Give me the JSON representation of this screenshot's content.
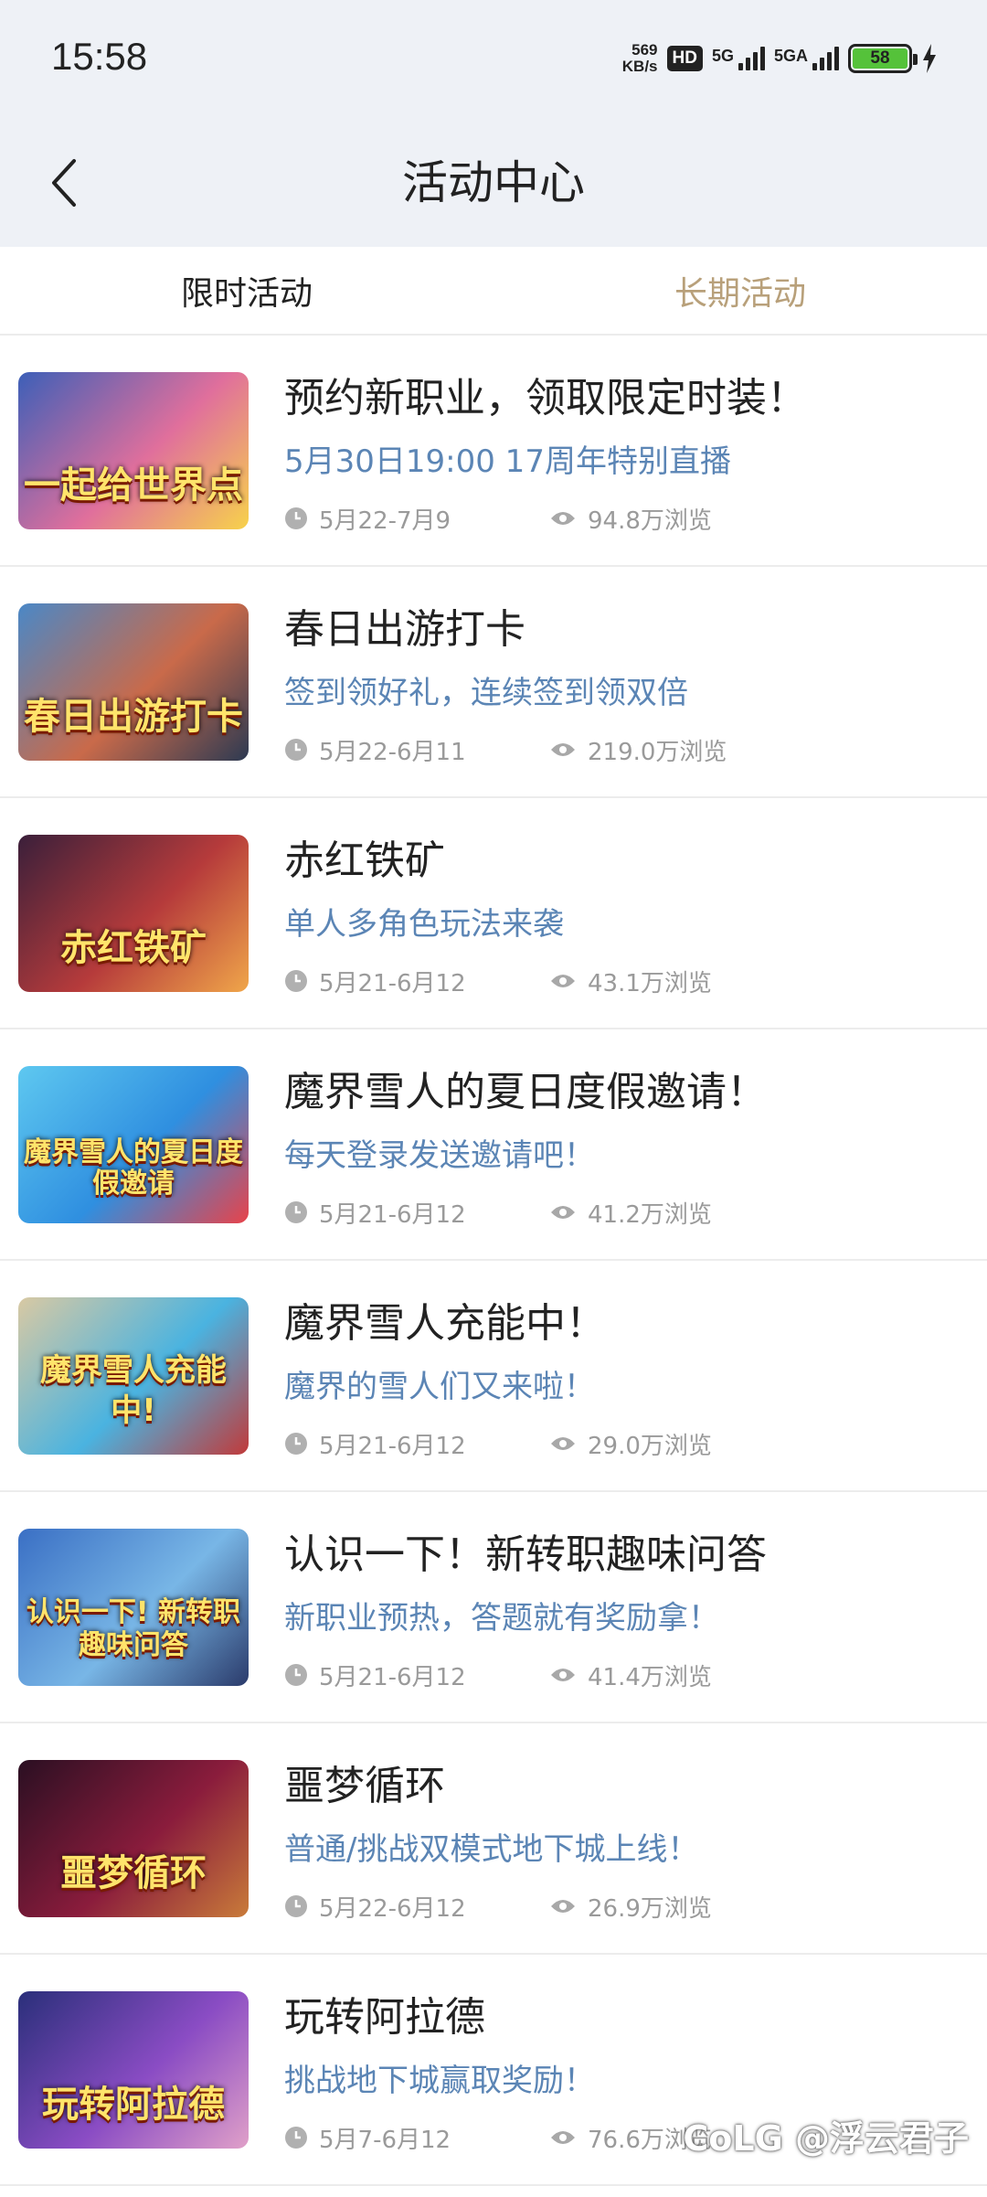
{
  "status": {
    "time": "15:58",
    "net_speed_value": "569",
    "net_speed_unit": "KB/s",
    "hd": "HD",
    "sim1": "5G",
    "sim2": "5GA",
    "battery": "58"
  },
  "header": {
    "title": "活动中心"
  },
  "tabs": [
    {
      "label": "限时活动",
      "active": true
    },
    {
      "label": "长期活动",
      "active": false
    }
  ],
  "items": [
    {
      "title": "预约新职业，领取限定时装！",
      "desc": "5月30日19:00 17周年特别直播",
      "date": "5月22-7月9",
      "views": "94.8万浏览",
      "thumb_text": "一起给世界点",
      "thumb_colors": [
        "#3c5fb8",
        "#e06f9c",
        "#f7d24b"
      ]
    },
    {
      "title": "春日出游打卡",
      "desc": "签到领好礼，连续签到领双倍",
      "date": "5月22-6月11",
      "views": "219.0万浏览",
      "thumb_text": "春日出游打卡",
      "thumb_colors": [
        "#4a88c7",
        "#c96a4a",
        "#2d3a52"
      ]
    },
    {
      "title": "赤红铁矿",
      "desc": "单人多角色玩法来袭",
      "date": "5月21-6月12",
      "views": "43.1万浏览",
      "thumb_text": "赤红铁矿",
      "thumb_colors": [
        "#3a1f3a",
        "#b63b3b",
        "#f0a64a"
      ]
    },
    {
      "title": "魔界雪人的夏日度假邀请！",
      "desc": "每天登录发送邀请吧！",
      "date": "5月21-6月12",
      "views": "41.2万浏览",
      "thumb_text": "魔界雪人的夏日度假邀请",
      "thumb_colors": [
        "#5ec8f0",
        "#2f8fe0",
        "#e8434a"
      ]
    },
    {
      "title": "魔界雪人充能中！",
      "desc": "魔界的雪人们又来啦！",
      "date": "5月21-6月12",
      "views": "29.0万浏览",
      "thumb_text": "魔界雪人充能中!",
      "thumb_colors": [
        "#d9c9a3",
        "#4ab3e0",
        "#c13a3a"
      ]
    },
    {
      "title": "认识一下！新转职趣味问答",
      "desc": "新职业预热，答题就有奖励拿！",
      "date": "5月21-6月12",
      "views": "41.4万浏览",
      "thumb_text": "认识一下! 新转职趣味问答",
      "thumb_colors": [
        "#3a6fc4",
        "#78b6e6",
        "#2b3b6b"
      ]
    },
    {
      "title": "噩梦循环",
      "desc": "普通/挑战双模式地下城上线！",
      "date": "5月22-6月12",
      "views": "26.9万浏览",
      "thumb_text": "噩梦循环",
      "thumb_colors": [
        "#2a0f22",
        "#8a1c3c",
        "#c97b3a"
      ]
    },
    {
      "title": "玩转阿拉德",
      "desc": "挑战地下城赢取奖励！",
      "date": "5月7-6月12",
      "views": "76.6万浏览",
      "thumb_text": "玩转阿拉德",
      "thumb_colors": [
        "#2a2f7a",
        "#8a4cc4",
        "#e0a0c8"
      ]
    }
  ],
  "watermark": "CoLG @浮云君子"
}
